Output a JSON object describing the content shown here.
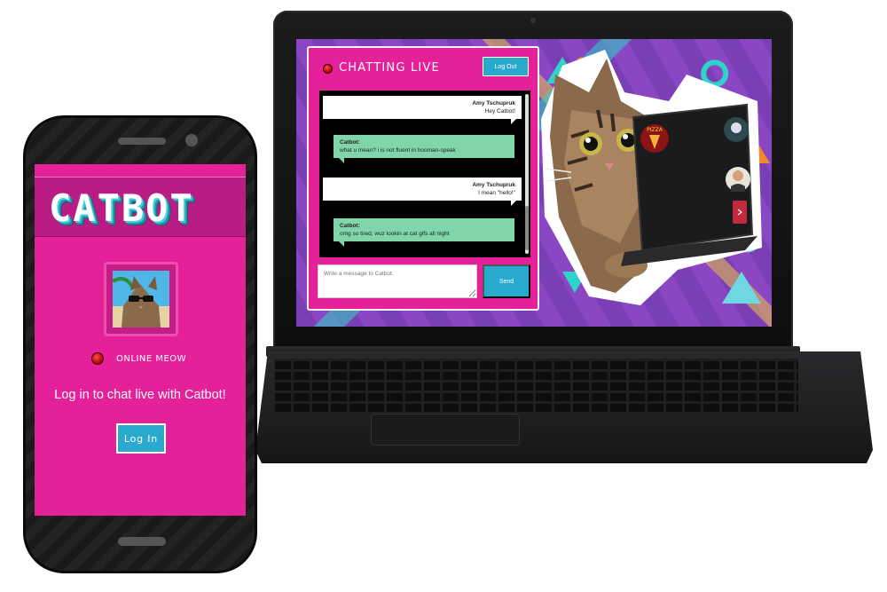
{
  "laptop": {
    "chat": {
      "title": "CHATTING LIVE",
      "logout_label": "Log Out",
      "messages": [
        {
          "sender": "Amy Tschupruk",
          "text": "Hey Catbot!"
        },
        {
          "sender": "Catbot:",
          "text": "what u mean? i is not fluent in hooman-speak"
        },
        {
          "sender": "Amy Tschupruk",
          "text": "I mean \"hello!\""
        },
        {
          "sender": "Catbot:",
          "text": "omg so tired, wuz lookin at cat gifs all night"
        }
      ],
      "input_placeholder": "Write a message to Catbot.",
      "send_label": "Send"
    },
    "sticker_text": "PIZZA"
  },
  "phone": {
    "logo": "CATBOT",
    "status": "ONLINE MEOW",
    "login_prompt": "Log in to chat live with Catbot!",
    "login_label": "Log In"
  },
  "colors": {
    "brand_pink": "#e5219a",
    "accent_blue": "#2aa9cf",
    "bot_bubble": "#80d6a8",
    "status_red": "#d00000"
  },
  "icons": [
    "live-status-dot-icon",
    "online-status-dot-icon"
  ]
}
